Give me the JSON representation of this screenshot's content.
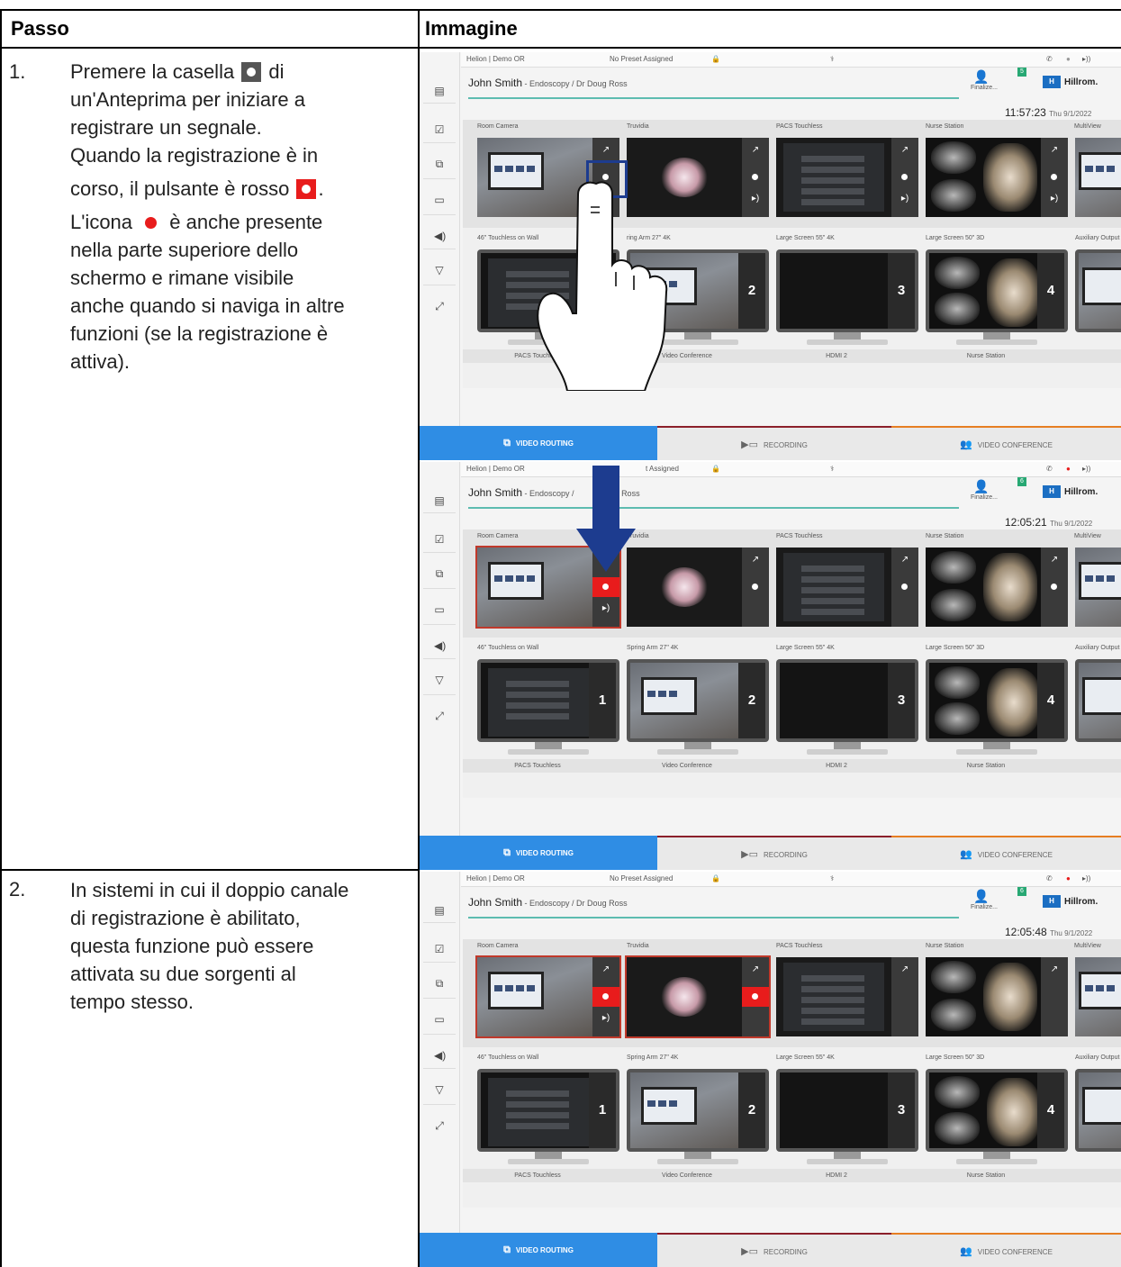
{
  "table": {
    "header_step": "Passo",
    "header_image": "Immagine"
  },
  "step1": {
    "number": "1.",
    "line1_a": "Premere la casella ",
    "line1_b": " di",
    "line2": "un'Anteprima per iniziare a",
    "line3": "registrare un segnale.",
    "line4": "Quando la registrazione è in",
    "line5_a": "corso, il pulsante è rosso ",
    "line5_b": ".",
    "line6_a": "L'icona ",
    "line6_b": " è anche presente",
    "line7": "nella parte superiore dello",
    "line8": "schermo e rimane visibile",
    "line9": "anche quando si naviga in altre",
    "line10": "funzioni (se la registrazione è",
    "line11": "attiva)."
  },
  "step2": {
    "number": "2.",
    "line1": "In sistemi in cui il doppio canale",
    "line2": "di registrazione è abilitato,",
    "line3": "questa funzione può essere",
    "line4": "attivata su due sorgenti al",
    "line5": "tempo stesso."
  },
  "ui": {
    "room": "Helion | Demo OR",
    "preset": "No Preset Assigned",
    "preset_partial": "t Assigned",
    "patient_name": "John Smith",
    "patient_detail": " - Endoscopy / Dr Doug Ross",
    "patient_detail_partial_a": " - Endoscopy /",
    "patient_detail_partial_b": "j Ross",
    "finalize": "Finalize...",
    "brand": "Hillrom.",
    "brand_mark": "H",
    "badge_1": "5",
    "badge_2": "6",
    "time_1": "11:57:23",
    "time_2": "12:05:21",
    "time_3": "12:05:48",
    "date": "Thu 9/1/2022",
    "sources": [
      "Room Camera",
      "Truvidia",
      "PACS Touchless",
      "Nurse Station",
      "MultiView"
    ],
    "destinations": [
      "46\" Touchless on Wall",
      "Spring Arm 27\" 4K",
      "Large Screen 55\" 4K",
      "Large Screen 50\" 3D",
      "Auxiliary Output"
    ],
    "dest_partial_2": "ring Arm 27\" 4K",
    "monitor_numbers": [
      "1",
      "2",
      "3",
      "4"
    ],
    "assigned": [
      "PACS Touchless",
      "Video Conference",
      "HDMI 2",
      "Nurse Station"
    ],
    "tab_routing": "VIDEO ROUTING",
    "tab_recording": "RECORDING",
    "tab_conference": "VIDEO CONFERENCE"
  },
  "colors": {
    "record_red": "#e81c1c",
    "active_tab": "#2f8de4",
    "highlight": "#1d3c8f"
  }
}
